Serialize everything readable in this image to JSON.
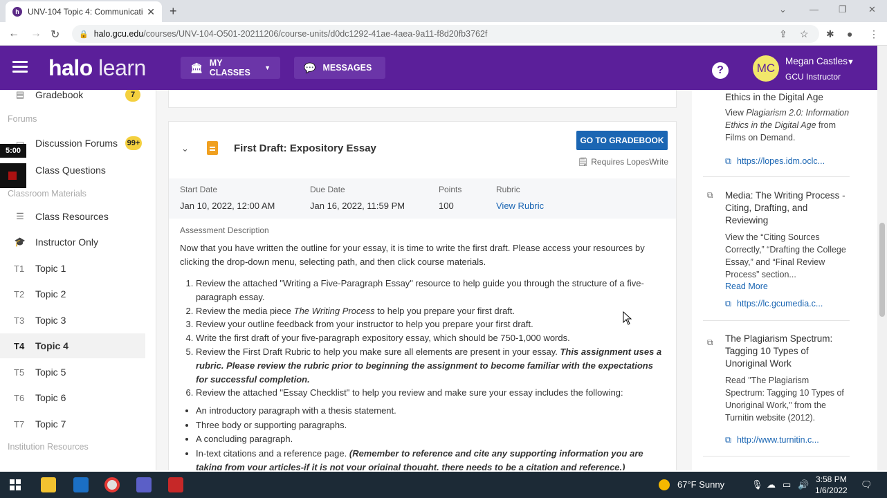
{
  "browser": {
    "tab_title": "UNV-104 Topic 4: Communicatin",
    "tab_favicon": "h",
    "url_domain": "halo.gcu.edu",
    "url_path": "/courses/UNV-104-O501-20211206/course-units/d0dc1292-41ae-4aea-9a11-f8d20fb3762f"
  },
  "header": {
    "logo_bold": "halo",
    "logo_light": " learn",
    "my_classes": "MY CLASSES",
    "messages": "MESSAGES",
    "help": "?",
    "avatar_initials": "MC",
    "user_name": "Megan Castles",
    "user_role": "GCU Instructor"
  },
  "overlay": {
    "time": "5:00"
  },
  "sidebar": {
    "gradebook": {
      "label": "Gradebook",
      "badge": "7"
    },
    "forums_section": "Forums",
    "discussion": {
      "label": "Discussion Forums",
      "badge": "99+"
    },
    "class_questions": "Class Questions",
    "materials_section": "Classroom Materials",
    "class_resources": "Class Resources",
    "instructor_only": "Instructor Only",
    "topics": [
      {
        "code": "T1",
        "label": "Topic 1"
      },
      {
        "code": "T2",
        "label": "Topic 2"
      },
      {
        "code": "T3",
        "label": "Topic 3"
      },
      {
        "code": "T4",
        "label": "Topic 4"
      },
      {
        "code": "T5",
        "label": "Topic 5"
      },
      {
        "code": "T6",
        "label": "Topic 6"
      },
      {
        "code": "T7",
        "label": "Topic 7"
      }
    ],
    "institution_section": "Institution Resources"
  },
  "assignment": {
    "title": "First Draft: Expository Essay",
    "gradebook_button": "GO TO GRADEBOOK",
    "requires": "Requires LopesWrite",
    "start_label": "Start Date",
    "start_value": "Jan 10, 2022, 12:00 AM",
    "due_label": "Due Date",
    "due_value": "Jan 16, 2022, 11:59 PM",
    "points_label": "Points",
    "points_value": "100",
    "rubric_label": "Rubric",
    "rubric_value": "View Rubric",
    "desc_label": "Assessment Description",
    "intro": "Now that you have written the outline for your essay, it is time to write the first draft. Please access your resources by clicking the drop-down menu, selecting path, and then click course materials.",
    "step1": "Review the attached \"Writing a Five-Paragraph Essay\" resource to help guide you through the structure of a five-paragraph essay.",
    "step2_a": "Review the media piece ",
    "step2_i": "The Writing Process",
    "step2_b": " to help you prepare your first draft.",
    "step3": "Review your outline feedback from your instructor to help you prepare your first draft.",
    "step4": "Write the first draft of your five-paragraph expository essay, which should be 750-1,000 words.",
    "step5_a": "Review the First Draft Rubric to help you make sure all elements are present in your essay. ",
    "step5_b": "This assignment uses a rubric. Please review the rubric prior to beginning the assignment to become familiar with the expectations for successful completion.",
    "step6": "Review the attached \"Essay Checklist\" to help you review and make sure your essay includes the following:",
    "check1": "An introductory paragraph with a thesis statement.",
    "check2": "Three body or supporting paragraphs.",
    "check3": "A concluding paragraph.",
    "check4_a": "In-text citations and a reference page. ",
    "check4_b": "(Remember to reference and cite any supporting information you are taking from your articles-if it is not your original thought, there needs to be a citation and reference.)"
  },
  "rail": {
    "item1": {
      "title": "Ethics in the Digital Age",
      "desc_a": "View ",
      "desc_i": "Plagiarism 2.0: Information Ethics in the Digital Age",
      "desc_b": " from Films on Demand.",
      "link": "https://lopes.idm.oclc..."
    },
    "item2": {
      "title": "Media: The Writing Process - Citing, Drafting, and Reviewing",
      "desc": "View the “Citing Sources Correctly,” “Drafting the College Essay,” and “Final Review Process” section...",
      "more": "Read More",
      "link": "https://lc.gcumedia.c..."
    },
    "item3": {
      "title": "The Plagiarism Spectrum: Tagging 10 Types of Unoriginal Work",
      "desc": "Read \"The Plagiarism Spectrum: Tagging 10 Types of Unoriginal Work,\" from the Turnitin website (2012).",
      "link": "http://www.turnitin.c..."
    }
  },
  "taskbar": {
    "weather": "67°F  Sunny",
    "time": "3:58 PM",
    "date": "1/6/2022"
  },
  "colors": {
    "brand": "#5b1f9a",
    "button_blue": "#1b66b3",
    "badge_yellow": "#f4d03f"
  }
}
